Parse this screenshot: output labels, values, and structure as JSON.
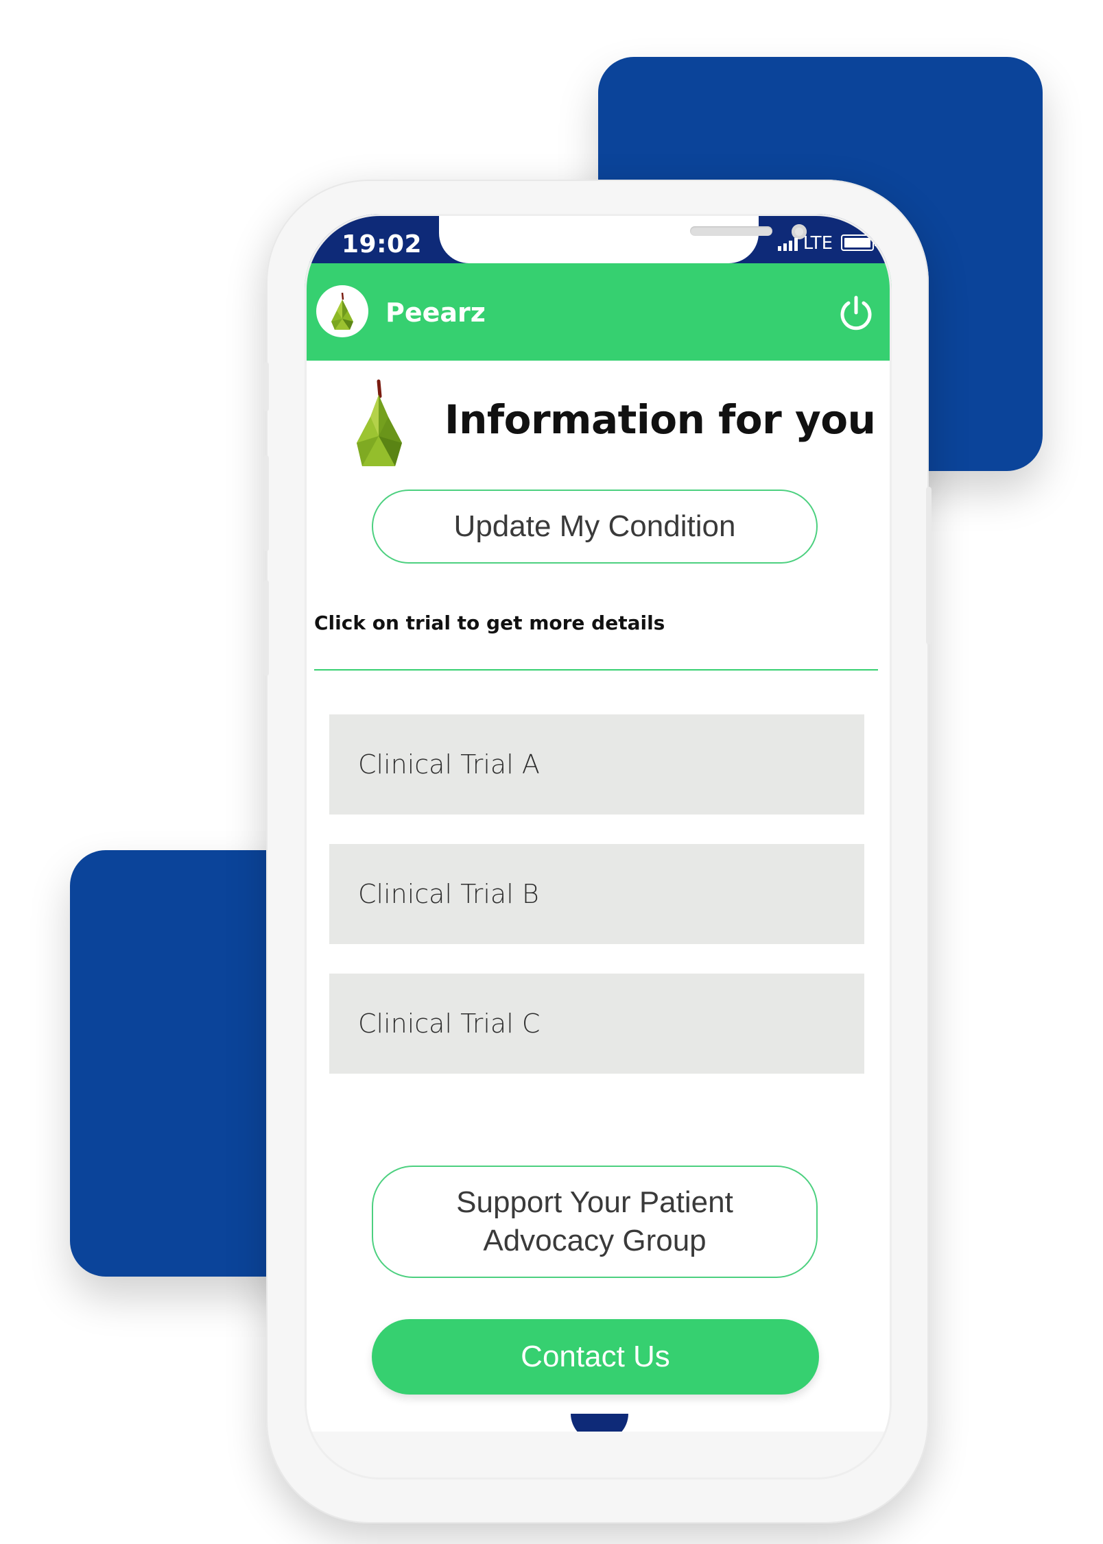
{
  "status_bar": {
    "time": "19:02",
    "network": "LTE"
  },
  "app_bar": {
    "app_name": "Peearz"
  },
  "page": {
    "title": "Information for you",
    "update_button": "Update My Condition",
    "hint": "Click on trial to get more details"
  },
  "trials": [
    {
      "label": "Clinical Trial A"
    },
    {
      "label": "Clinical Trial B"
    },
    {
      "label": "Clinical Trial C"
    }
  ],
  "support_button": {
    "line1": "Support Your Patient",
    "line2": "Advocacy Group"
  },
  "contact_button": "Contact Us",
  "colors": {
    "brand_green": "#36d070",
    "brand_blue": "#0b449a",
    "status_bar": "#0e2a78",
    "trial_bg": "#e7e8e6"
  },
  "icons": {
    "logo": "pear-icon",
    "power": "power-icon",
    "hero": "pear-icon"
  }
}
